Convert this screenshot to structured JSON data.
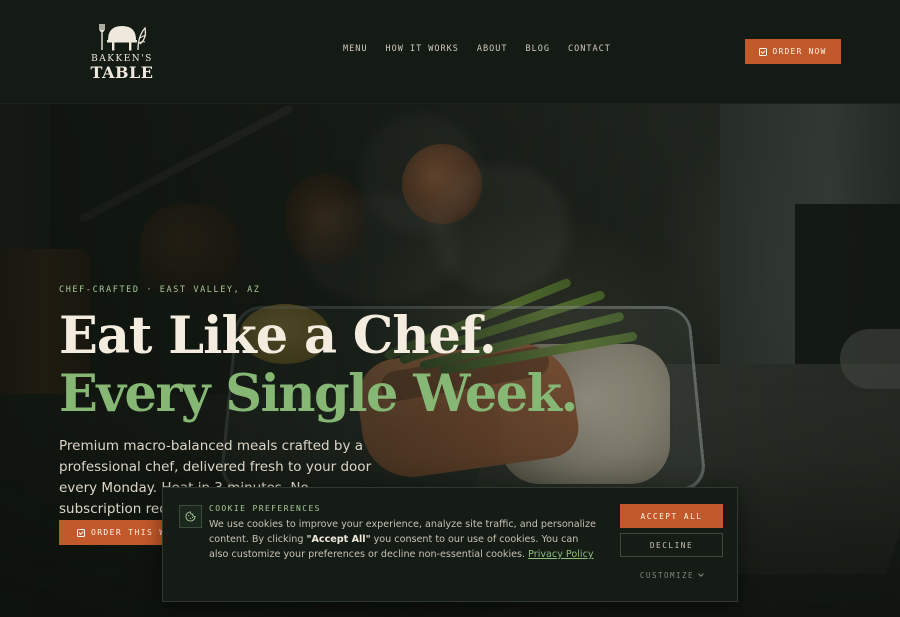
{
  "brand": {
    "name_small": "BAKKEN'S",
    "name_big": "TABLE"
  },
  "nav": {
    "items": [
      "MENU",
      "HOW IT WORKS",
      "ABOUT",
      "BLOG",
      "CONTACT"
    ]
  },
  "header": {
    "order_label": "ORDER NOW"
  },
  "hero": {
    "eyebrow": "CHEF-CRAFTED · EAST VALLEY, AZ",
    "headline_line1": "Eat Like a Chef.",
    "headline_line2": "Every Single Week.",
    "body": "Premium macro-balanced meals crafted by a professional chef, delivered fresh to your door every Monday. Heat in 3 minutes. No subscription required.",
    "cta_label": "ORDER THIS WEEK"
  },
  "cookie_banner": {
    "title": "COOKIE PREFERENCES",
    "text_before": "We use cookies to improve your experience, analyze site traffic, and personalize content. By clicking ",
    "text_bold": "\"Accept All\"",
    "text_after": " you consent to our use of cookies. You can also customize your preferences or decline non-essential cookies. ",
    "link_label": "Privacy Policy",
    "accept_label": "ACCEPT ALL",
    "decline_label": "DECLINE",
    "customize_label": "CUSTOMIZE"
  },
  "colors": {
    "accent": "#c2592a",
    "green_text": "#86b774",
    "eyebrow_green": "#a9c899",
    "background": "#141b14"
  },
  "icons": {
    "logo": "chef-hat-fork-leaf-logo",
    "order_button": "bag-check-icon",
    "cookie": "cookie-icon",
    "customize": "chevron-down-icon"
  }
}
